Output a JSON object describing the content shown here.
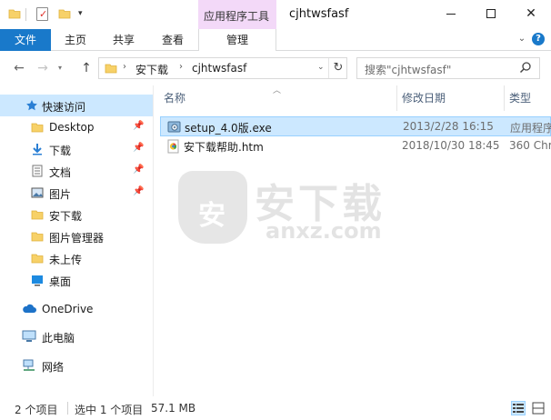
{
  "window": {
    "title": "cjhtwsfasf",
    "contextual_group": "应用程序工具"
  },
  "ribbon": {
    "tabs": [
      {
        "label": "文件"
      },
      {
        "label": "主页"
      },
      {
        "label": "共享"
      },
      {
        "label": "查看"
      },
      {
        "label": "管理"
      }
    ]
  },
  "address": {
    "crumbs": [
      "安下载",
      "cjhtwsfasf"
    ],
    "search_placeholder": "搜索\"cjhtwsfasf\""
  },
  "sidebar": {
    "items": [
      {
        "label": "快速访问",
        "icon": "star-icon"
      },
      {
        "label": "Desktop",
        "icon": "folder-icon",
        "pinned": true
      },
      {
        "label": "下载",
        "icon": "download-icon",
        "pinned": true
      },
      {
        "label": "文档",
        "icon": "document-icon",
        "pinned": true
      },
      {
        "label": "图片",
        "icon": "picture-icon",
        "pinned": true
      },
      {
        "label": "安下载",
        "icon": "folder-icon"
      },
      {
        "label": "图片管理器",
        "icon": "folder-icon"
      },
      {
        "label": "未上传",
        "icon": "folder-icon"
      },
      {
        "label": "桌面",
        "icon": "desktop-icon"
      },
      {
        "label": "OneDrive",
        "icon": "cloud-icon"
      },
      {
        "label": "此电脑",
        "icon": "computer-icon"
      },
      {
        "label": "网络",
        "icon": "network-icon"
      }
    ]
  },
  "filelist": {
    "columns": {
      "name": "名称",
      "date": "修改日期",
      "type": "类型"
    },
    "rows": [
      {
        "name": "setup_4.0版.exe",
        "date": "2013/2/28 16:15",
        "type": "应用程序",
        "icon": "installer-icon",
        "selected": true
      },
      {
        "name": "安下载帮助.htm",
        "date": "2018/10/30 18:45",
        "type": "360 Chr",
        "icon": "html-file-icon",
        "selected": false
      }
    ]
  },
  "watermark": {
    "brand": "安下载",
    "domain": "anxz.com"
  },
  "status": {
    "count": "2 个项目",
    "selected": "选中 1 个项目",
    "size": "57.1 MB"
  },
  "colors": {
    "accent": "#1979ca",
    "selection": "#cce8ff",
    "context_tab": "#f3d9f8"
  }
}
